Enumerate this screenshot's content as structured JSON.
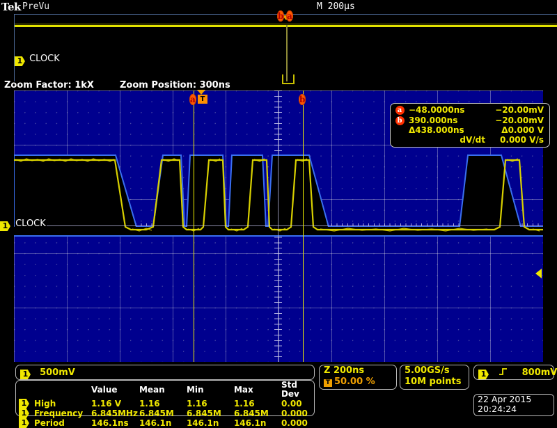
{
  "header": {
    "brand": "Tek",
    "acq_state": "PreVu",
    "main_timebase": "M 200µs"
  },
  "overview": {
    "channel_badge": "1",
    "channel_label": "CLOCK"
  },
  "zoom_strip": {
    "zoom_factor": "Zoom Factor: 1kX",
    "zoom_position": "Zoom Position: 300ns"
  },
  "zoom_window": {
    "channel_badge": "1",
    "channel_label": "CLOCK",
    "cursor_a_flag": "a",
    "cursor_b_flag": "b",
    "trigger_flag": "T"
  },
  "cursor_readout": {
    "rows": [
      {
        "flag": "a",
        "time": "−48.0000ns",
        "volts": "−20.00mV"
      },
      {
        "flag": "b",
        "time": "390.000ns",
        "volts": "−20.00mV"
      },
      {
        "flag": "",
        "time": "Δ438.000ns",
        "volts": "Δ0.000 V"
      },
      {
        "flag": "",
        "time": "dV/dt",
        "volts": "0.000 V/s"
      }
    ]
  },
  "vertical_bar": {
    "channel_badge": "1",
    "scale": "500mV"
  },
  "measurements": {
    "headers": [
      "",
      "",
      "Value",
      "Mean",
      "Min",
      "Max",
      "Std Dev"
    ],
    "rows": [
      {
        "ch": "1",
        "name": "High",
        "value": "1.16 V",
        "mean": "1.16",
        "min": "1.16",
        "max": "1.16",
        "std": "0.00"
      },
      {
        "ch": "1",
        "name": "Frequency",
        "value": "6.845MHz",
        "mean": "6.845M",
        "min": "6.845M",
        "max": "6.845M",
        "std": "0.000"
      },
      {
        "ch": "1",
        "name": "Period",
        "value": "146.1ns",
        "mean": "146.1n",
        "min": "146.1n",
        "max": "146.1n",
        "std": "0.000"
      }
    ]
  },
  "horizontal_bar": {
    "zoom_scale": "Z 200ns",
    "trigger_badge": "T",
    "trigger_pos": "50.00 %"
  },
  "acquisition": {
    "sample_rate": "5.00GS/s",
    "record_length": "10M points"
  },
  "trigger_bar": {
    "channel_badge": "1",
    "slope_icon": "rising-edge-icon",
    "level": "800mV"
  },
  "datetime": {
    "date": "22 Apr 2015",
    "time": "20:24:24"
  },
  "colors": {
    "channel_yellow": "#f0e800",
    "graticule_blue": "#00008e",
    "cursor_orange": "#ff5a00",
    "trigger_orange": "#f0a000"
  }
}
